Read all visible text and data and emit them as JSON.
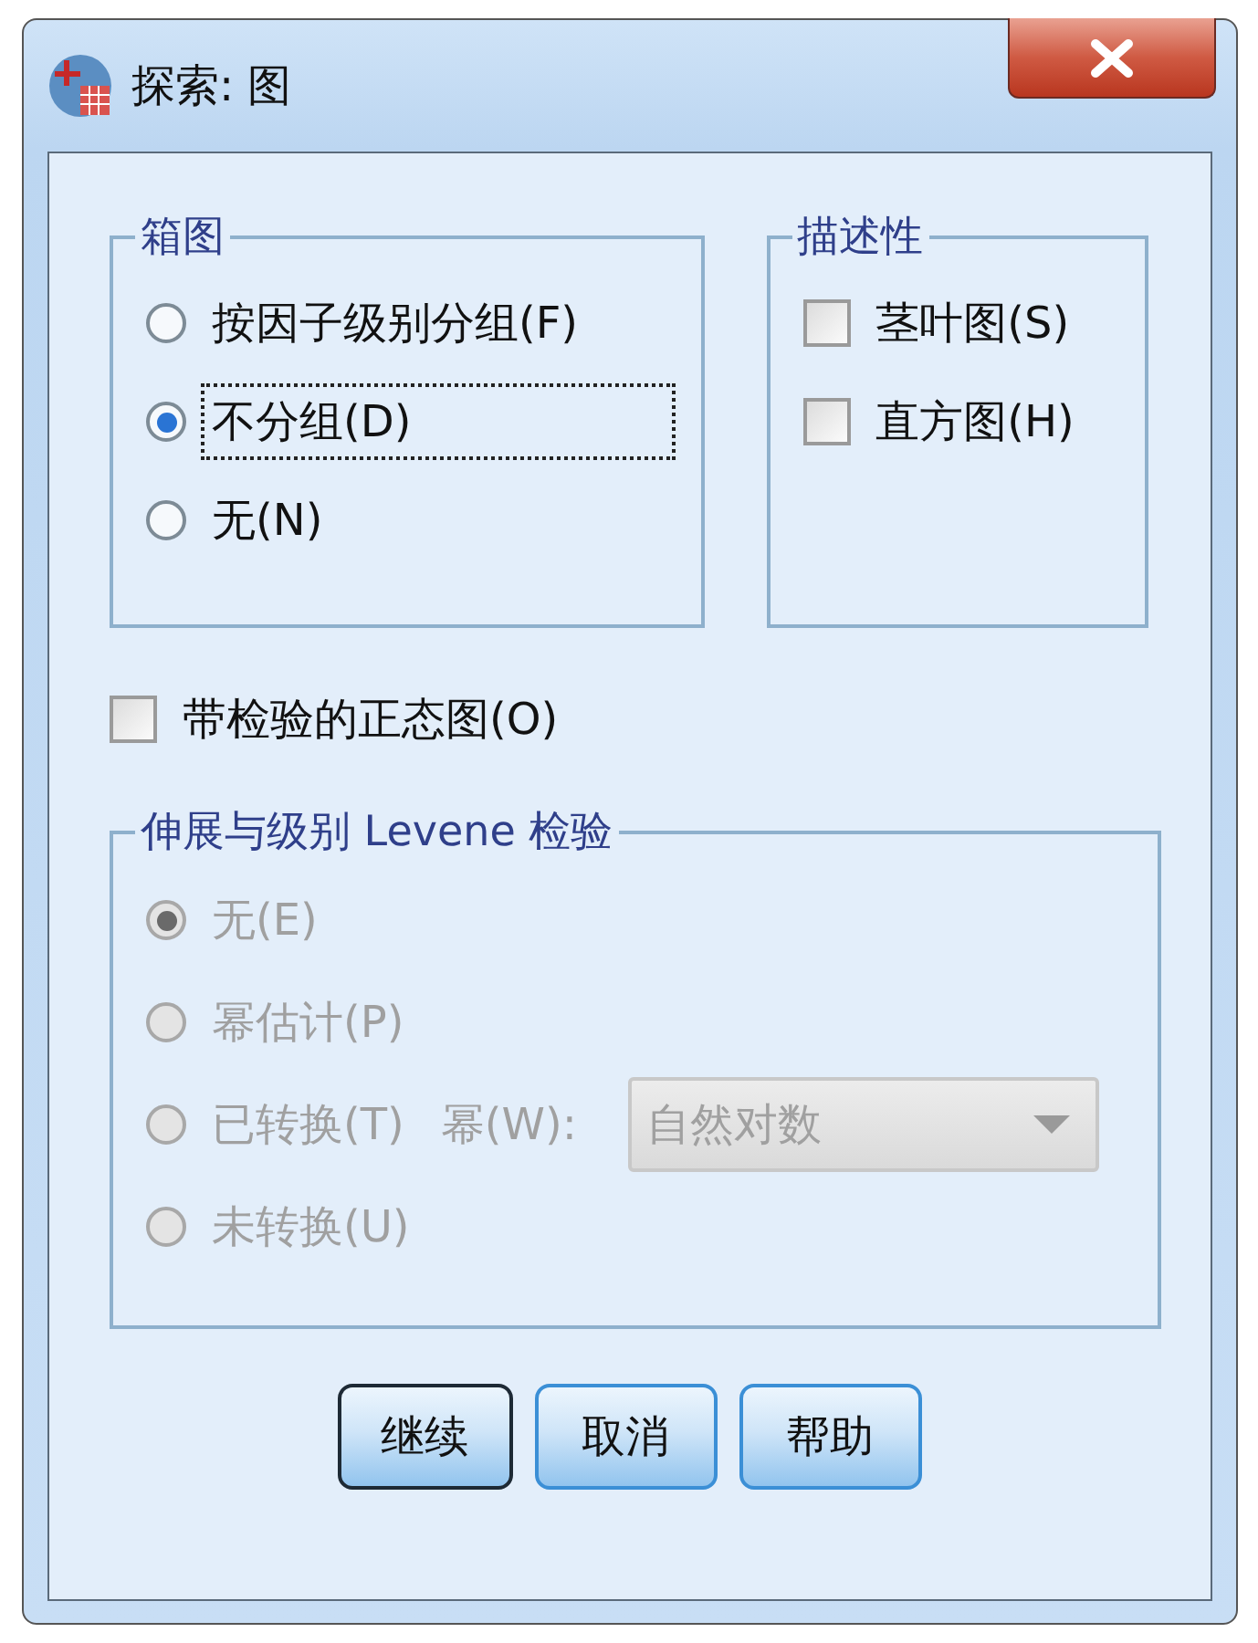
{
  "window": {
    "title": "探索: 图"
  },
  "boxplots": {
    "title": "箱图",
    "options": [
      {
        "label": "按因子级别分组(F)",
        "selected": false,
        "focused": false
      },
      {
        "label": "不分组(D)",
        "selected": true,
        "focused": true
      },
      {
        "label": "无(N)",
        "selected": false,
        "focused": false
      }
    ]
  },
  "descriptive": {
    "title": "描述性",
    "options": [
      {
        "label": "茎叶图(S)",
        "checked": false
      },
      {
        "label": "直方图(H)",
        "checked": false
      }
    ]
  },
  "normality_plots": {
    "label": "带检验的正态图(O)",
    "checked": false
  },
  "spread_vs_level": {
    "title": "伸展与级别 Levene 检验",
    "disabled": true,
    "options": [
      {
        "kind": "plain",
        "label": "无(E)",
        "selected": true
      },
      {
        "kind": "plain",
        "label": "幂估计(P)",
        "selected": false
      },
      {
        "kind": "power",
        "label": "已转换(T)",
        "selected": false,
        "power_label": "幂(W):",
        "power_value": "自然对数"
      },
      {
        "kind": "plain",
        "label": "未转换(U)",
        "selected": false
      }
    ]
  },
  "buttons": [
    {
      "label": "继续",
      "default": true
    },
    {
      "label": "取消",
      "default": false
    },
    {
      "label": "帮助",
      "default": false
    }
  ]
}
